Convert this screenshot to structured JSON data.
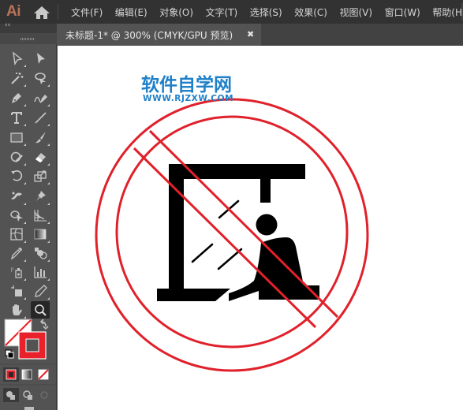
{
  "app": {
    "logo": "Ai",
    "menu": [
      "文件(F)",
      "编辑(E)",
      "对象(O)",
      "文字(T)",
      "选择(S)",
      "效果(C)",
      "视图(V)",
      "窗口(W)",
      "帮助(H)"
    ]
  },
  "document": {
    "tab_title": "未标题-1* @ 300% (CMYK/GPU 预览)",
    "close_glyph": "✖"
  },
  "toolbar": {
    "collapse_glyph": "‹‹",
    "tools": [
      {
        "name": "direct-selection-tool"
      },
      {
        "name": "selection-tool"
      },
      {
        "name": "magic-wand-tool"
      },
      {
        "name": "lasso-tool"
      },
      {
        "name": "pen-tool"
      },
      {
        "name": "curvature-tool"
      },
      {
        "name": "type-tool"
      },
      {
        "name": "line-segment-tool"
      },
      {
        "name": "rectangle-tool"
      },
      {
        "name": "paintbrush-tool"
      },
      {
        "name": "shaper-tool"
      },
      {
        "name": "eraser-tool"
      },
      {
        "name": "rotate-tool"
      },
      {
        "name": "scale-tool"
      },
      {
        "name": "puppet-warp-tool"
      },
      {
        "name": "pin-tool"
      },
      {
        "name": "shape-builder-tool"
      },
      {
        "name": "perspective-grid-tool"
      },
      {
        "name": "mesh-tool"
      },
      {
        "name": "gradient-tool"
      },
      {
        "name": "eyedropper-tool"
      },
      {
        "name": "blend-tool"
      },
      {
        "name": "symbol-sprayer-tool"
      },
      {
        "name": "column-graph-tool"
      },
      {
        "name": "artboard-tool"
      },
      {
        "name": "slice-tool"
      },
      {
        "name": "hand-tool"
      },
      {
        "name": "zoom-tool"
      }
    ],
    "active_tool": "zoom-tool",
    "fill_color": "none",
    "stroke_color": "#e8212a"
  },
  "canvas": {
    "watermark_cn": "软件自学网",
    "watermark_en": "WWW.RJZXW.COM",
    "sign_color": "#e0212b",
    "icon_color": "#000000"
  }
}
